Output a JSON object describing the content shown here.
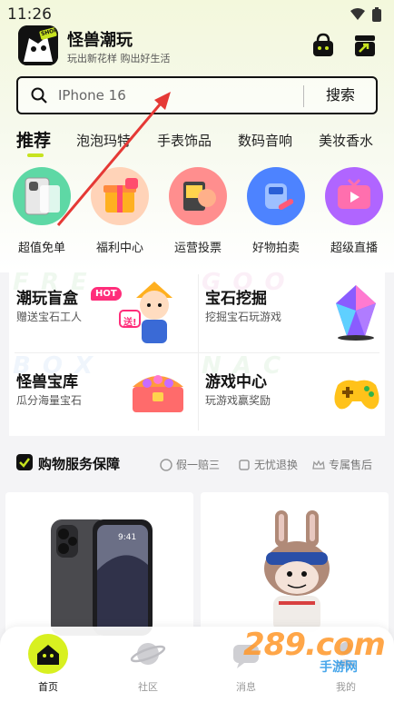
{
  "status": {
    "time": "11:26"
  },
  "header": {
    "app_name": "怪兽潮玩",
    "slogan": "玩出新花样 购出好生活",
    "logo_text": "SHOP"
  },
  "search": {
    "value": "IPhone 16",
    "button": "搜索"
  },
  "tabs": [
    "推荐",
    "泡泡玛特",
    "手表饰品",
    "数码音响",
    "美妆香水"
  ],
  "quick_entries": [
    {
      "label": "超值免单",
      "icon": "phone-box-icon",
      "color": "#5ed8a5"
    },
    {
      "label": "福利中心",
      "icon": "gift-box-icon",
      "color": "#ffd3b8"
    },
    {
      "label": "运营投票",
      "icon": "vote-card-icon",
      "color": "#ff8e8e"
    },
    {
      "label": "好物拍卖",
      "icon": "auction-bag-icon",
      "color": "#4d83ff"
    },
    {
      "label": "超级直播",
      "icon": "live-tv-icon",
      "color": "#b065ff"
    }
  ],
  "features": [
    {
      "title": "潮玩盲盒",
      "badge": "HOT",
      "sub": "赠送宝石工人",
      "art": "hero-figure-icon",
      "sticker": "送!"
    },
    {
      "title": "宝石挖掘",
      "sub": "挖掘宝石玩游戏",
      "art": "gem-crystal-icon"
    },
    {
      "title": "怪兽宝库",
      "sub": "瓜分海量宝石",
      "art": "treasure-chest-icon"
    },
    {
      "title": "游戏中心",
      "sub": "玩游戏赢奖励",
      "art": "gamepad-icon"
    }
  ],
  "guarantee": {
    "title": "购物服务保障",
    "items": [
      "假一赔三",
      "无忧退换",
      "专属售后"
    ]
  },
  "products": [
    {
      "name": "iphone-product",
      "art": "smartphone-icon"
    },
    {
      "name": "labubu-product",
      "art": "bunny-figure-icon"
    }
  ],
  "bottom_nav": [
    {
      "label": "首页",
      "icon": "home-monster-icon",
      "active": true
    },
    {
      "label": "社区",
      "icon": "planet-icon",
      "active": false
    },
    {
      "label": "消息",
      "icon": "message-icon",
      "active": false
    },
    {
      "label": "我的",
      "icon": "profile-icon",
      "active": false
    }
  ],
  "watermark": {
    "text": "289.com",
    "sub": "手游网"
  },
  "colors": {
    "accent": "#c7e31f",
    "hot": "#ff2d7a",
    "arrow": "#e53935"
  }
}
